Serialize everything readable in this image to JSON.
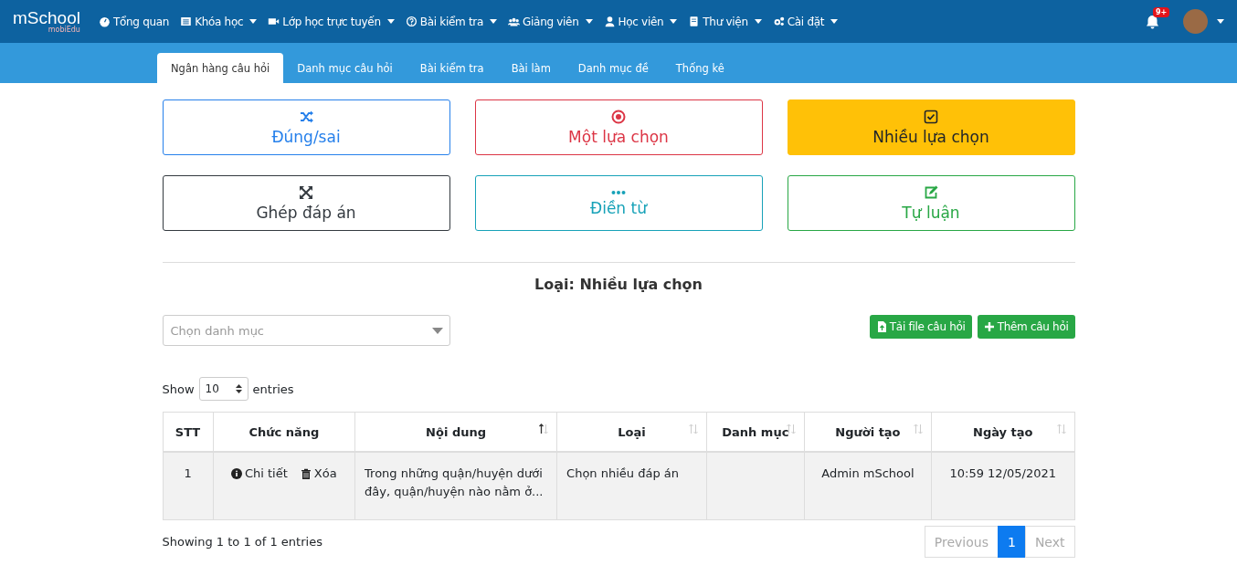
{
  "logo": {
    "main": "mSchool",
    "sub": "mobiEdu"
  },
  "nav": [
    {
      "label": "Tổng quan",
      "dropdown": false
    },
    {
      "label": "Khóa học",
      "dropdown": true
    },
    {
      "label": "Lớp học trực tuyến",
      "dropdown": true
    },
    {
      "label": "Bài kiểm tra",
      "dropdown": true
    },
    {
      "label": "Giảng viên",
      "dropdown": true
    },
    {
      "label": "Học viên",
      "dropdown": true
    },
    {
      "label": "Thư viện",
      "dropdown": true
    },
    {
      "label": "Cài đặt",
      "dropdown": true
    }
  ],
  "notifications": {
    "badge": "9+"
  },
  "tabs": [
    {
      "label": "Ngân hàng câu hỏi",
      "selected": true
    },
    {
      "label": "Danh mục câu hỏi",
      "selected": false
    },
    {
      "label": "Bài kiểm tra",
      "selected": false
    },
    {
      "label": "Bài làm",
      "selected": false
    },
    {
      "label": "Danh mục đề",
      "selected": false
    },
    {
      "label": "Thống kê",
      "selected": false
    }
  ],
  "question_types": [
    {
      "label": "Đúng/sai",
      "color": "#2680eb",
      "selected": false
    },
    {
      "label": "Một lựa chọn",
      "color": "#dc3545",
      "selected": false
    },
    {
      "label": "Nhiều lựa chọn",
      "color": "#ffc107",
      "selected": true
    },
    {
      "label": "Ghép đáp án",
      "color": "#343a40",
      "selected": false
    },
    {
      "label": "Điền từ",
      "color": "#17a2b8",
      "selected": false
    },
    {
      "label": "Tự luận",
      "color": "#28a745",
      "selected": false
    }
  ],
  "type_heading": "Loại: Nhiều lựa chọn",
  "category_select": {
    "placeholder": "Chọn danh mục"
  },
  "actions": [
    {
      "label": "Tải file câu hỏi"
    },
    {
      "label": "Thêm câu hỏi"
    }
  ],
  "length": {
    "before": "Show",
    "value": "10",
    "after": "entries"
  },
  "table": {
    "columns": [
      {
        "label": "STT",
        "sortable": false,
        "sorted": false
      },
      {
        "label": "Chức năng",
        "sortable": false,
        "sorted": false
      },
      {
        "label": "Nội dung",
        "sortable": true,
        "sorted": true
      },
      {
        "label": "Loại",
        "sortable": true,
        "sorted": false
      },
      {
        "label": "Danh mục",
        "sortable": true,
        "sorted": false
      },
      {
        "label": "Người tạo",
        "sortable": true,
        "sorted": false
      },
      {
        "label": "Ngày tạo",
        "sortable": true,
        "sorted": false
      }
    ],
    "rows": [
      {
        "stt": "1",
        "detail": "Chi tiết",
        "delete": "Xóa",
        "content": "Trong những quận/huyện dưới đây, quận/huyện nào nằm ở...",
        "type": "Chọn nhiều đáp án",
        "category": "",
        "creator": "Admin mSchool",
        "created": "10:59 12/05/2021"
      }
    ]
  },
  "info": "Showing 1 to 1 of 1 entries",
  "pagination": [
    {
      "label": "Previous",
      "selected": false,
      "disabled": true
    },
    {
      "label": "1",
      "selected": true,
      "disabled": false
    },
    {
      "label": "Next",
      "selected": false,
      "disabled": true
    }
  ]
}
